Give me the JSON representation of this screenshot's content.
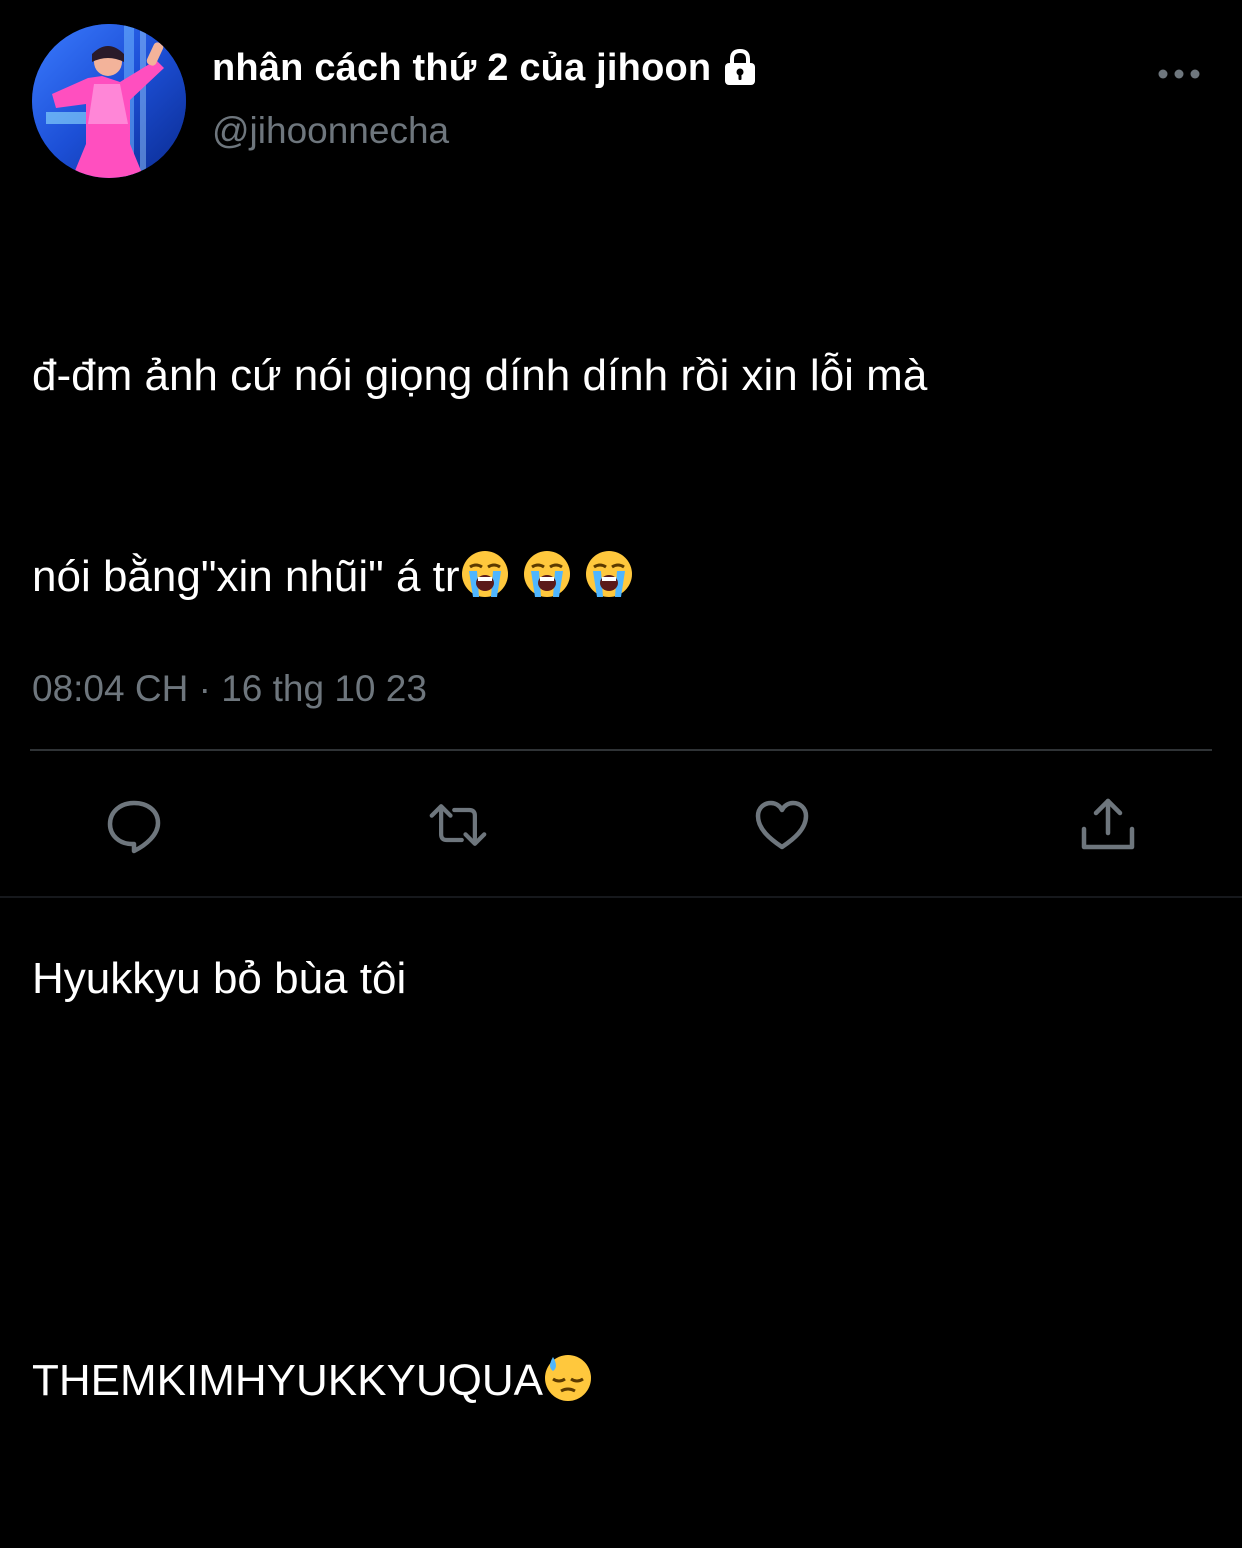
{
  "author": {
    "display_name": "nhân cách thứ 2 của jihoon",
    "handle": "@jihoonnecha",
    "protected_icon": "lock-icon",
    "avatar": "profile-photo"
  },
  "tweet": {
    "line1": "đ-đm ảnh cứ nói giọng dính dính rồi xin lỗi mà",
    "line2_text": "nói bằng\"xin nhũi\" á tr",
    "line2_emojis": [
      "loudly-crying-face",
      "loudly-crying-face",
      "loudly-crying-face"
    ],
    "line3": "Hyukkyu bỏ bùa tôi",
    "line4_text": "THEMKIMHYUKKYUQUA",
    "line4_emoji": "downcast-face-with-sweat"
  },
  "timestamp": "08:04 CH · 16 thg 10 23",
  "actions": [
    {
      "name": "reply",
      "icon": "reply-icon"
    },
    {
      "name": "retweet",
      "icon": "retweet-icon"
    },
    {
      "name": "like",
      "icon": "heart-icon"
    },
    {
      "name": "share",
      "icon": "share-icon"
    }
  ],
  "colors": {
    "background": "#000000",
    "text": "#ffffff",
    "secondary": "#6e767d",
    "divider": "#2f3336"
  }
}
